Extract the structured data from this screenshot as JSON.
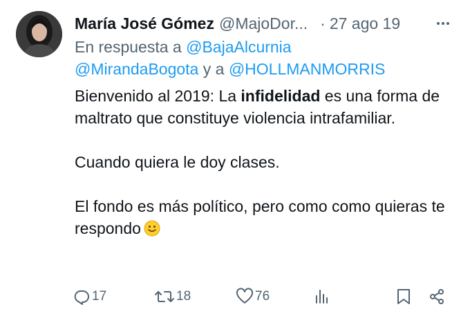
{
  "tweet": {
    "author_name": "María José Gómez",
    "author_handle": "@MajoDor...",
    "separator": "·",
    "timestamp": "27 ago 19",
    "reply_prefix": "En respuesta a",
    "reply_mention_1": "@BajaAlcurnia",
    "reply_mention_2": "@MirandaBogota",
    "reply_conj": "y a",
    "reply_mention_3": "@HOLLMANMORRIS",
    "para1_a": "Bienvenido al 2019: La ",
    "para1_bold": "infidelidad",
    "para1_b": " es una forma de maltrato que constituye violencia intrafamiliar.",
    "para2": "Cuando quiera le doy clases.",
    "para3": "El fondo es más político, pero como como quieras te respondo"
  },
  "actions": {
    "replies": "17",
    "retweets": "18",
    "likes": "76"
  },
  "icons": [
    "more-icon",
    "reply-icon",
    "retweet-icon",
    "like-icon",
    "views-icon",
    "bookmark-icon",
    "share-icon",
    "smile-emoji-icon"
  ],
  "colors": {
    "link": "#1d9bf0",
    "secondary": "#536471",
    "text": "#0f1419"
  }
}
